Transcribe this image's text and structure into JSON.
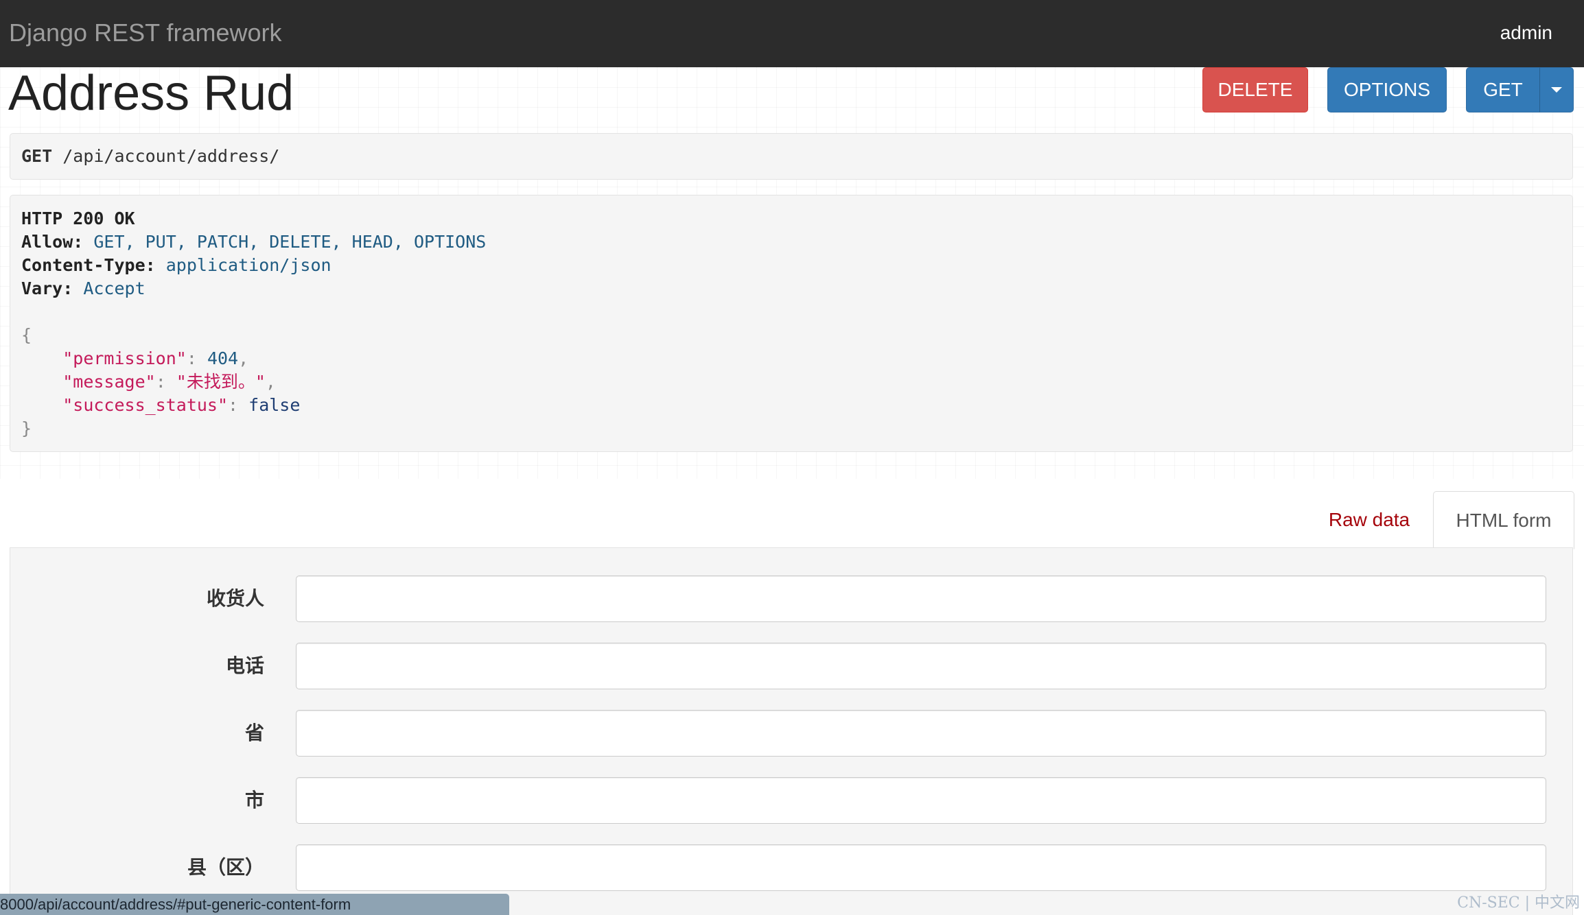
{
  "navbar": {
    "brand": "Django REST framework",
    "user": "admin"
  },
  "page": {
    "title": "Address Rud"
  },
  "toolbar": {
    "delete_label": "DELETE",
    "options_label": "OPTIONS",
    "get_label": "GET"
  },
  "request": {
    "method": "GET",
    "path": "/api/account/address/"
  },
  "response": {
    "status": "HTTP 200 OK",
    "headers": [
      {
        "name": "Allow:",
        "value": "GET, PUT, PATCH, DELETE, HEAD, OPTIONS"
      },
      {
        "name": "Content-Type:",
        "value": "application/json"
      },
      {
        "name": "Vary:",
        "value": "Accept"
      }
    ],
    "body": {
      "open": "{",
      "close": "}",
      "fields": [
        {
          "key": "\"permission\"",
          "value": "404",
          "comma": ","
        },
        {
          "key": "\"message\"",
          "value": "\"未找到。\"",
          "comma": ","
        },
        {
          "key": "\"success_status\"",
          "value": "false",
          "comma": ""
        }
      ]
    }
  },
  "tabs": {
    "raw": "Raw data",
    "html": "HTML form"
  },
  "form": {
    "fields": [
      {
        "label": "收货人",
        "value": ""
      },
      {
        "label": "电话",
        "value": ""
      },
      {
        "label": "省",
        "value": ""
      },
      {
        "label": "市",
        "value": ""
      },
      {
        "label": "县（区）",
        "value": ""
      }
    ]
  },
  "status_bar": {
    "url": "8000/api/account/address/#put-generic-content-form"
  },
  "watermark": "CN-SEC | 中文网",
  "colors": {
    "navbar": "#2c2c2c",
    "delete": "#d9534f",
    "primary": "#337ab7",
    "raw_tab": "#a5040b"
  }
}
